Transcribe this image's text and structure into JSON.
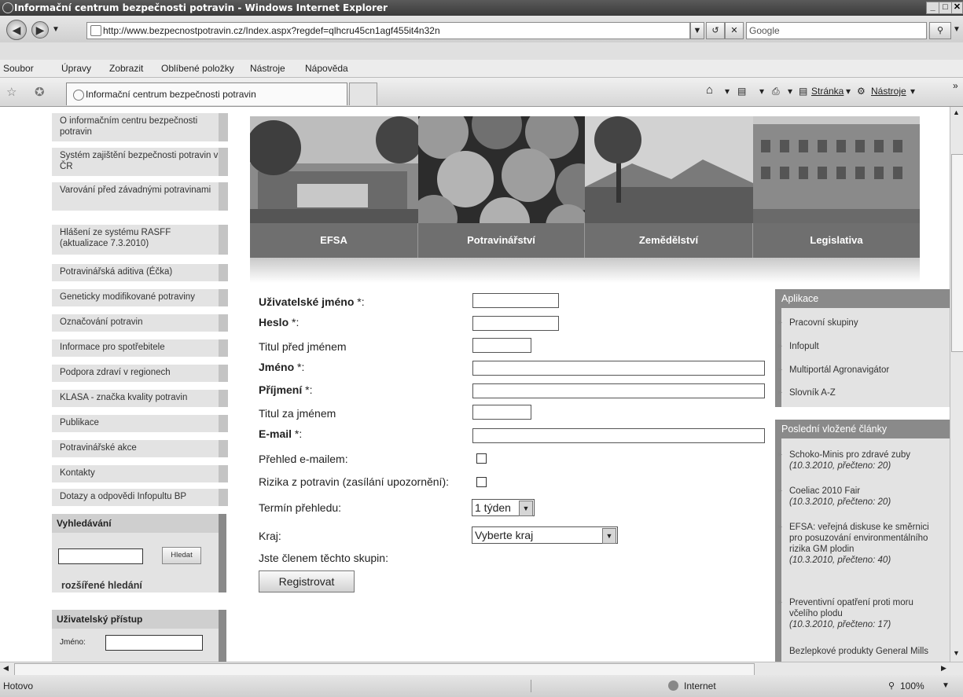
{
  "window": {
    "title": "Informační centrum bezpečnosti potravin - Windows Internet Explorer",
    "address": "http://www.bezpecnostpotravin.cz/Index.aspx?regdef=qlhcru45cn1agf455it4n32n",
    "search_placeholder": "Google"
  },
  "menu": [
    "Soubor",
    "Úpravy",
    "Zobrazit",
    "Oblíbené položky",
    "Nástroje",
    "Nápověda"
  ],
  "tab": {
    "title": "Informační centrum bezpečnosti potravin"
  },
  "commandbar": {
    "page": "Stránka",
    "tools": "Nástroje"
  },
  "sidebar": {
    "items": [
      "O informačním centru bezpečnosti potravin",
      "Systém zajištění bezpečnosti potravin v ČR",
      "Varování před závadnými potravinami",
      "Hlášení ze systému RASFF (aktualizace 7.3.2010)",
      "Potravinářská aditiva (Éčka)",
      "Geneticky modifikované potraviny",
      "Označování potravin",
      "Informace pro spotřebitele",
      "Podpora zdraví v regionech",
      "KLASA - značka kvality potravin",
      "Publikace",
      "Potravinářské akce",
      "Kontakty",
      "Dotazy a odpovědi Infopultu BP"
    ],
    "search": {
      "title": "Vyhledávání",
      "button": "Hledat",
      "advanced": "rozšířené hledání"
    },
    "login": {
      "title": "Uživatelský přístup",
      "name_label": "Jméno:"
    }
  },
  "banner": [
    "EFSA",
    "Potravinářství",
    "Zemědělství",
    "Legislativa"
  ],
  "form": {
    "username": "Uživatelské jméno",
    "password": "Heslo",
    "title_before": "Titul před jménem",
    "first_name": "Jméno",
    "last_name": "Příjmení",
    "title_after": "Titul za jménem",
    "email": "E-mail",
    "required_mark": " *:",
    "overview_email": "Přehled e-mailem:",
    "risks": "Rizika z potravin (zasílání upozornění):",
    "overview_term": "Termín přehledu:",
    "term_value": "1 týden",
    "region": "Kraj:",
    "region_value": "Vyberte kraj",
    "groups": "Jste členem těchto skupin:",
    "submit": "Registrovat"
  },
  "apps": {
    "title": "Aplikace",
    "items": [
      "Pracovní skupiny",
      "Infopult",
      "Multiportál Agronavigátor",
      "Slovník A-Z"
    ]
  },
  "articles": {
    "title": "Poslední vložené články",
    "items": [
      {
        "title": "Schoko-Minis pro zdravé zuby",
        "meta": "(10.3.2010, přečteno: 20)"
      },
      {
        "title": "Coeliac 2010 Fair",
        "meta": "(10.3.2010, přečteno: 20)"
      },
      {
        "title": "EFSA: veřejná diskuse ke směrnici pro posuzování environmentálního rizika GM plodin",
        "meta": "(10.3.2010, přečteno: 40)"
      },
      {
        "title": "Preventivní opatření proti moru včelího plodu",
        "meta": "(10.3.2010, přečteno: 17)"
      },
      {
        "title": "Bezlepkové produkty General Mills",
        "meta": ""
      }
    ]
  },
  "status": {
    "left": "Hotovo",
    "zone": "Internet",
    "zoom": "100%"
  }
}
